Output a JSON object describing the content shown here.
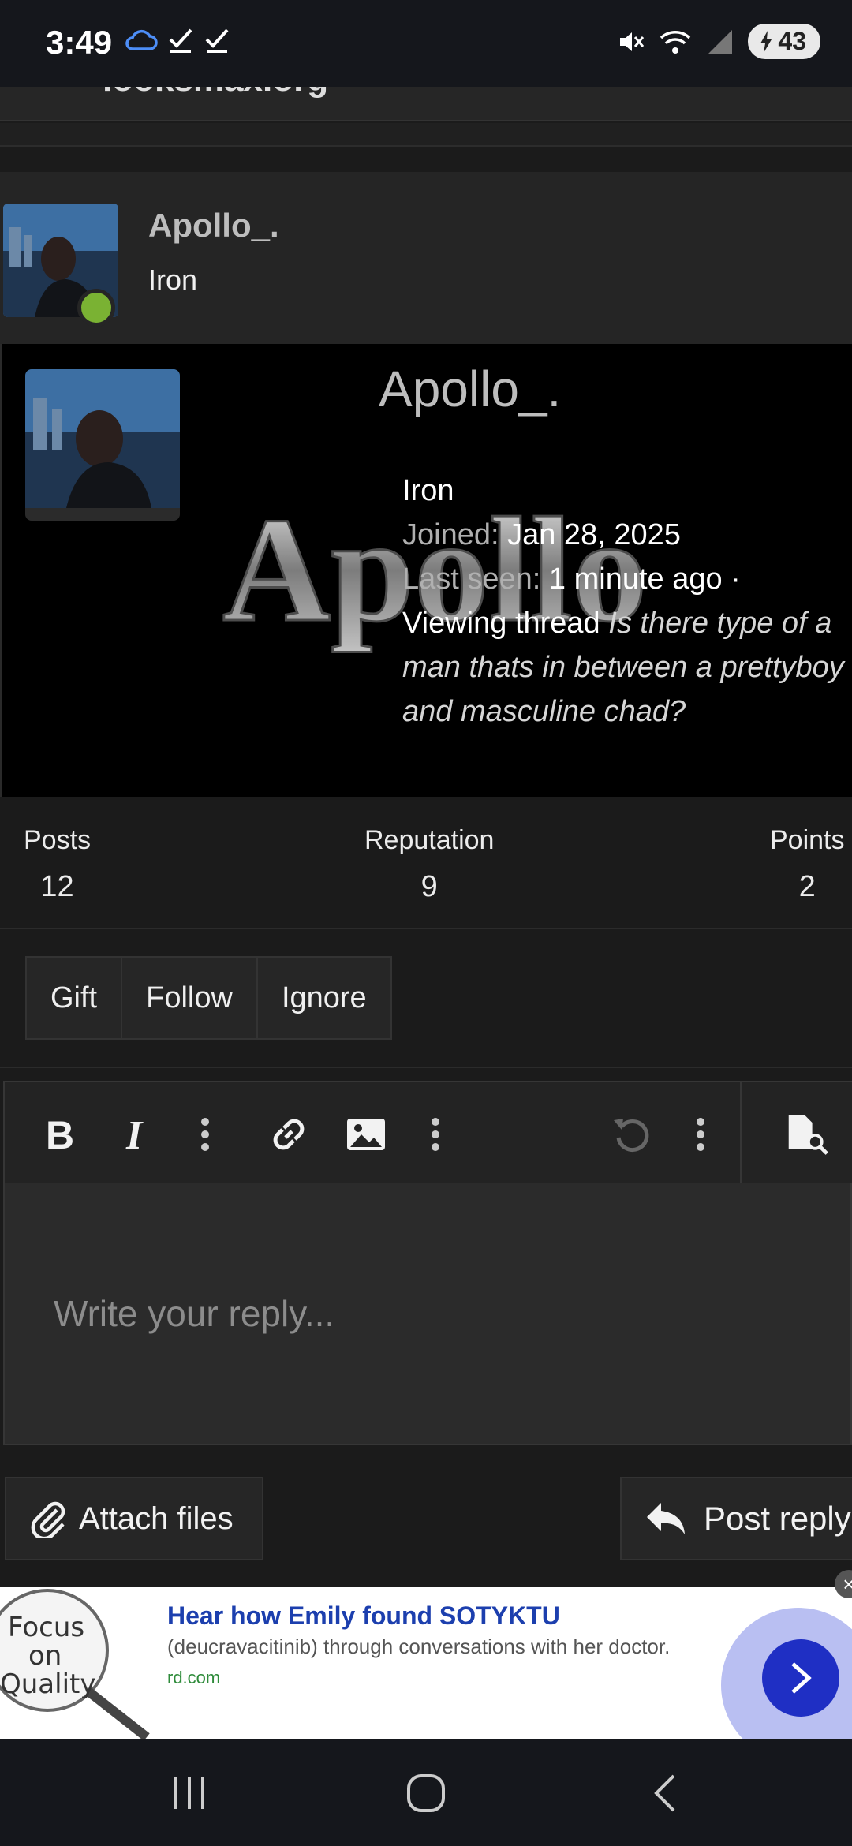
{
  "status_bar": {
    "time": "3:49",
    "battery": "43"
  },
  "member": {
    "name": "Apollo_.",
    "rank": "Iron"
  },
  "profile_card": {
    "name": "Apollo_.",
    "rank": "Iron",
    "joined_label": "Joined:",
    "joined_value": "Jan 28, 2025",
    "last_seen_label": "Last seen:",
    "last_seen_value": "1 minute ago ·",
    "activity_label": "Viewing thread",
    "activity_thread": "Is there type of a man thats in between a prettyboy and masculine chad?",
    "banner_text": "Apollo"
  },
  "stats": [
    {
      "label": "Posts",
      "value": "12"
    },
    {
      "label": "Reputation",
      "value": "9"
    },
    {
      "label": "Points",
      "value": "2"
    }
  ],
  "actions": {
    "gift": "Gift",
    "follow": "Follow",
    "ignore": "Ignore"
  },
  "editor": {
    "placeholder": "Write your reply...",
    "attach_label": "Attach files",
    "post_label": "Post reply"
  },
  "ad": {
    "badge_text": "Focus on Quality",
    "title": "Hear how Emily found SOTYKTU",
    "description": "(deucravacitinib) through conversations with her doctor.",
    "url": "rd.com"
  },
  "colors": {
    "online": "#7ab233",
    "ad_title": "#1c3fae",
    "ad_cta": "#1f2fc4"
  }
}
